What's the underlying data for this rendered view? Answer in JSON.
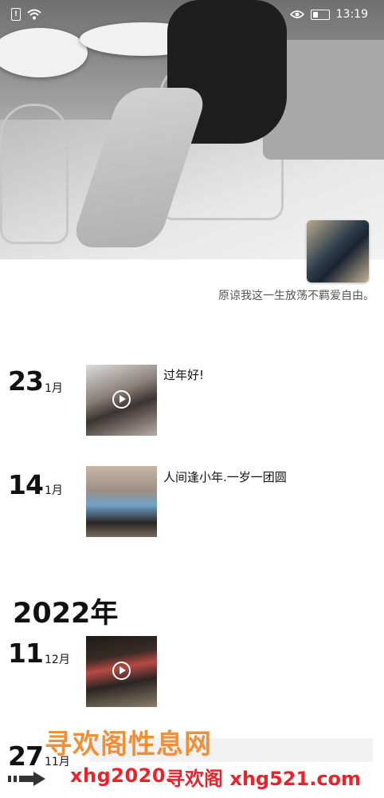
{
  "status_bar": {
    "time": "13:19",
    "sim_label": "!"
  },
  "profile": {
    "signature": "原谅我这一生放荡不羁爱自由。"
  },
  "posts": [
    {
      "day": "23",
      "month": "1月",
      "caption": "过年好!",
      "has_video": true
    },
    {
      "day": "14",
      "month": "1月",
      "caption": "人间逢小年.一岁一团圆",
      "has_video": false
    },
    {
      "day": "11",
      "month": "12月",
      "caption": "",
      "has_video": true
    },
    {
      "day": "27",
      "month": "11月",
      "caption": "",
      "has_video": false
    }
  ],
  "year_header": "2022年",
  "watermark": {
    "line1": "寻欢阁性息网",
    "line2a": "xhg2020.",
    "line2b": "寻欢阁 xhg521.com"
  },
  "colors": {
    "watermark_orange": "#f08f3a",
    "watermark_red": "#e8232b"
  },
  "icons": [
    "wifi-icon",
    "eye-icon",
    "battery-icon",
    "play-icon",
    "arrow-icon"
  ]
}
